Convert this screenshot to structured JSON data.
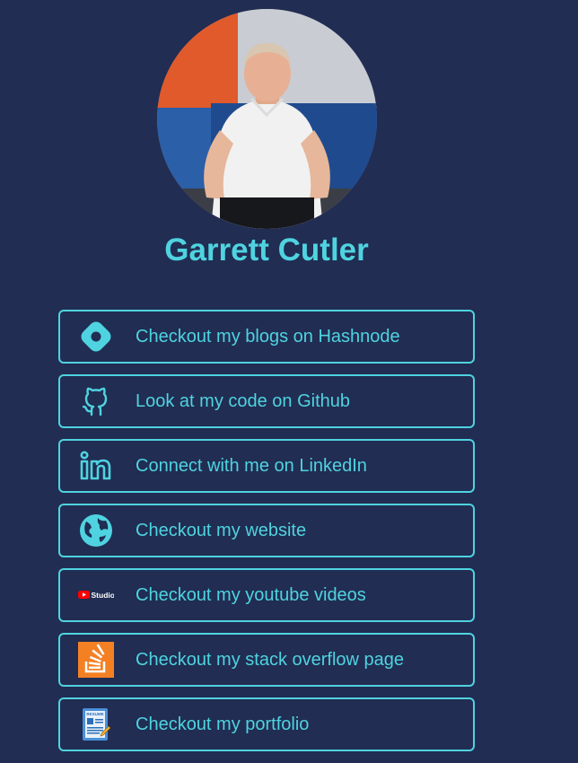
{
  "profile": {
    "name": "Garrett Cutler"
  },
  "links": [
    {
      "label": "Checkout my blogs on Hashnode",
      "icon": "hashnode-icon"
    },
    {
      "label": "Look at my code on Github",
      "icon": "github-icon"
    },
    {
      "label": "Connect with me on LinkedIn",
      "icon": "linkedin-icon"
    },
    {
      "label": "Checkout my website",
      "icon": "globe-icon"
    },
    {
      "label": "Checkout my youtube videos",
      "icon": "youtube-studio-icon",
      "icon_text": "Studio"
    },
    {
      "label": "Checkout my stack overflow page",
      "icon": "stack-overflow-icon"
    },
    {
      "label": "Checkout my portfolio",
      "icon": "resume-icon",
      "icon_text": "RESUME"
    }
  ],
  "colors": {
    "background": "#212d52",
    "accent": "#4fd3e0"
  }
}
